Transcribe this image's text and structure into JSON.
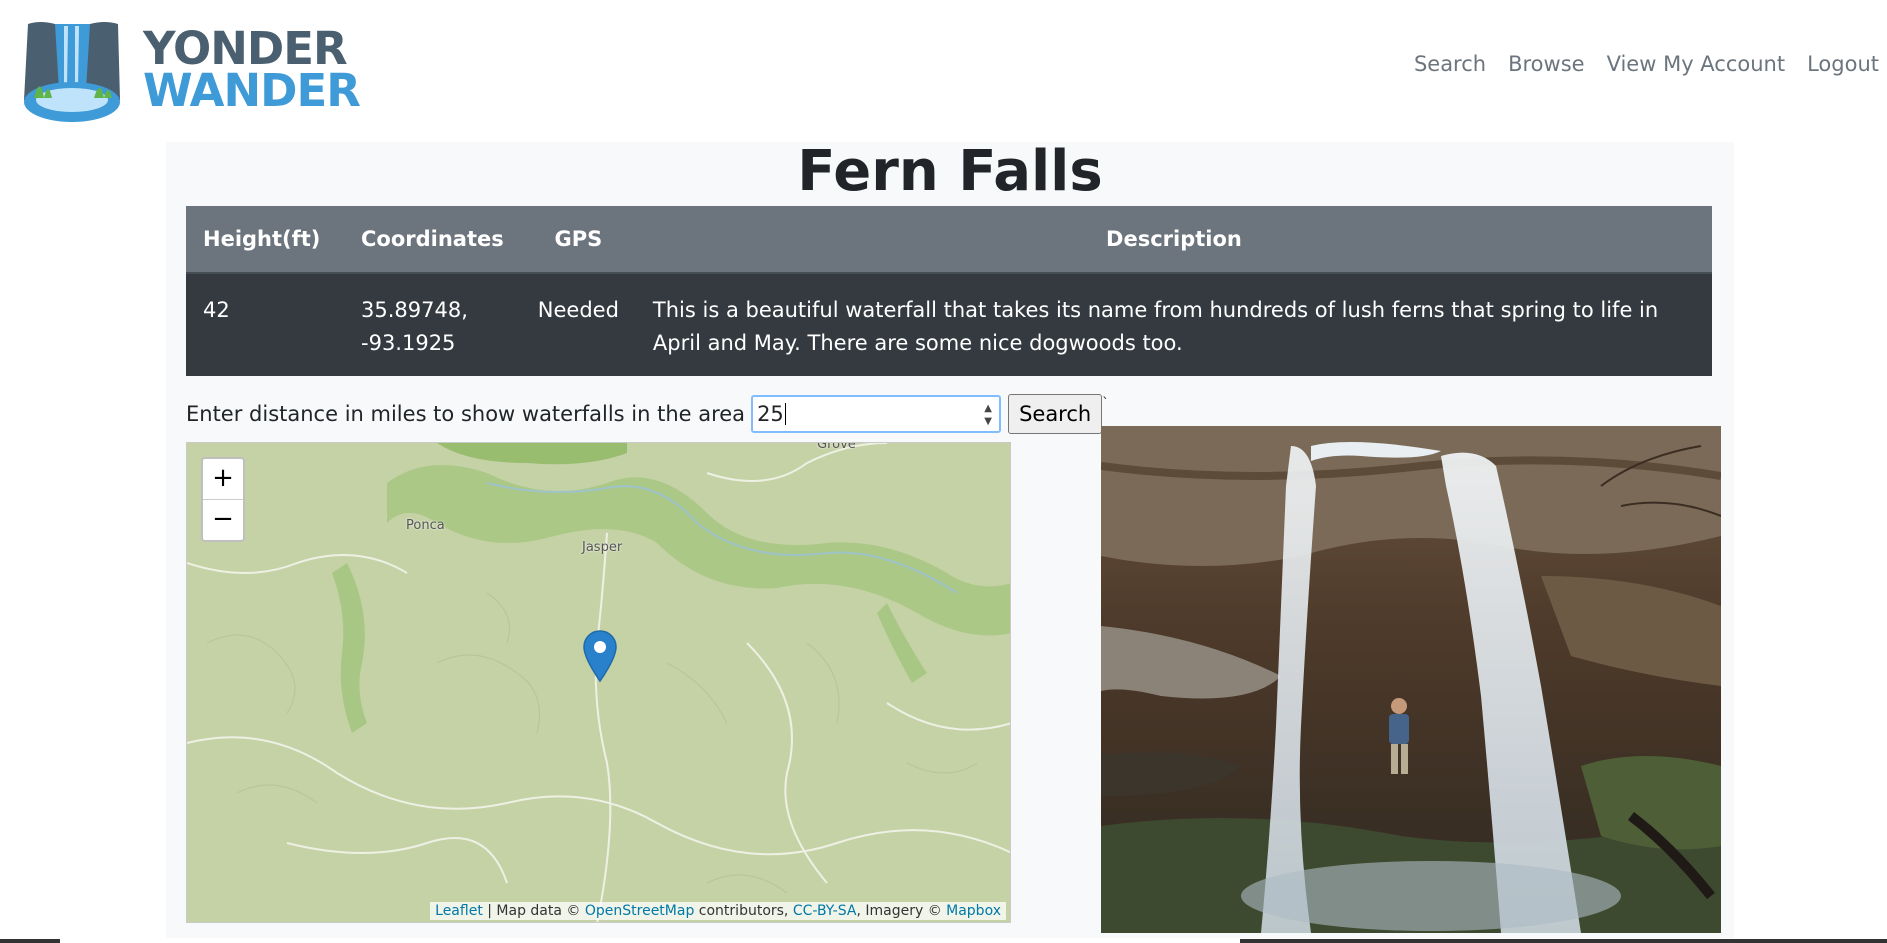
{
  "brand": {
    "line1": "YONDER",
    "line2": "WANDER"
  },
  "nav": [
    {
      "label": "Search"
    },
    {
      "label": "Browse"
    },
    {
      "label": "View My Account"
    },
    {
      "label": "Logout"
    }
  ],
  "title": "Fern Falls",
  "table": {
    "headers": [
      "Height(ft)",
      "Coordinates",
      "GPS",
      "Description"
    ],
    "row": {
      "height": "42",
      "coordinates": "35.89748, -93.1925",
      "gps": "Needed",
      "description": "This is a beautiful waterfall that takes its name from hundreds of lush ferns that spring to life in April and May. There are some nice dogwoods too."
    }
  },
  "search": {
    "label": "Enter distance in miles to show waterfalls in the area",
    "value": "25",
    "button": "Search"
  },
  "map": {
    "zoom_in": "+",
    "zoom_out": "−",
    "places": [
      "Ponca",
      "Jasper",
      "Grove"
    ],
    "attribution": {
      "leaflet": "Leaflet",
      "sep1": " | Map data © ",
      "osm": "OpenStreetMap",
      "contrib": " contributors, ",
      "license": "CC-BY-SA",
      "imagery": ", Imagery © ",
      "mapbox": "Mapbox"
    }
  },
  "photo_tick": "`",
  "colors": {
    "table_header": "#6c757d",
    "table_body": "#343a40",
    "nav": "#6c757d",
    "brand_dark": "#4a6070",
    "brand_blue": "#3f9ad8",
    "map_land": "#c7d3a8",
    "marker": "#2a81cb"
  }
}
